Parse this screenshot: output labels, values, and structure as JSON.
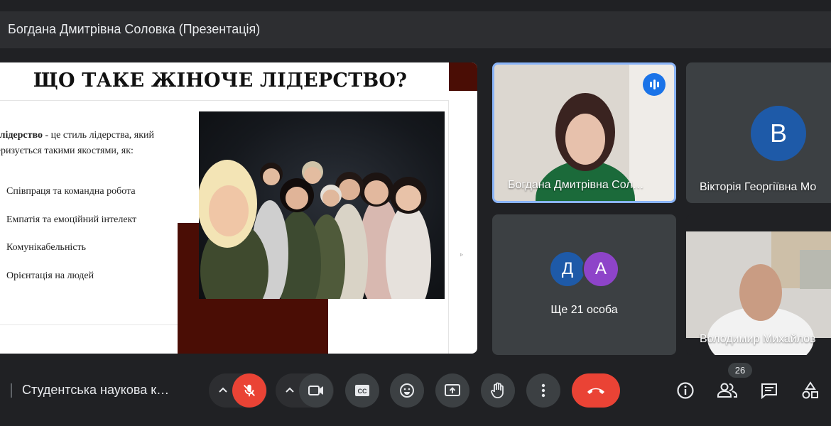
{
  "header": {
    "title": "Богдана Дмитрівна Соловка (Презентація)"
  },
  "slide": {
    "title": "ЩО ТАКЕ ЖІНОЧЕ ЛІДЕРСТВО?",
    "intro_bold": "че лідерство",
    "intro_rest": " - це стиль лідерства, який",
    "intro_line2": "ктеризується такими якостями, як:",
    "bullets": [
      "Співпраця та командна робота",
      "Емпатія та емоційний інтелект",
      "Комунікабельність",
      "Орієнтація на людей"
    ]
  },
  "participants": {
    "tile1_name": "Богдана Дмитрівна Сол…",
    "tile2_name": "Вікторія Георгіївна Мо",
    "tile2_initial": "В",
    "tile3_initials": [
      "Д",
      "А"
    ],
    "tile3_label": "Ще 21 особа",
    "tile4_name": "Володимир Михайлов"
  },
  "footer": {
    "meeting_title": "Студентська наукова к…",
    "participant_count": "26"
  },
  "icons": {
    "mic": "mic-off-icon",
    "camera": "videocam-icon",
    "captions": "closed-captions-icon",
    "emoji": "emoji-icon",
    "present": "present-screen-icon",
    "hand": "raise-hand-icon",
    "more": "more-vert-icon",
    "end": "call-end-icon",
    "info": "info-icon",
    "people": "people-icon",
    "chat": "chat-icon",
    "activities": "activities-icon"
  },
  "colors": {
    "accent_red": "#ea4335",
    "speaking_border": "#8ab4f8",
    "slide_maroon": "#4a0d05"
  }
}
